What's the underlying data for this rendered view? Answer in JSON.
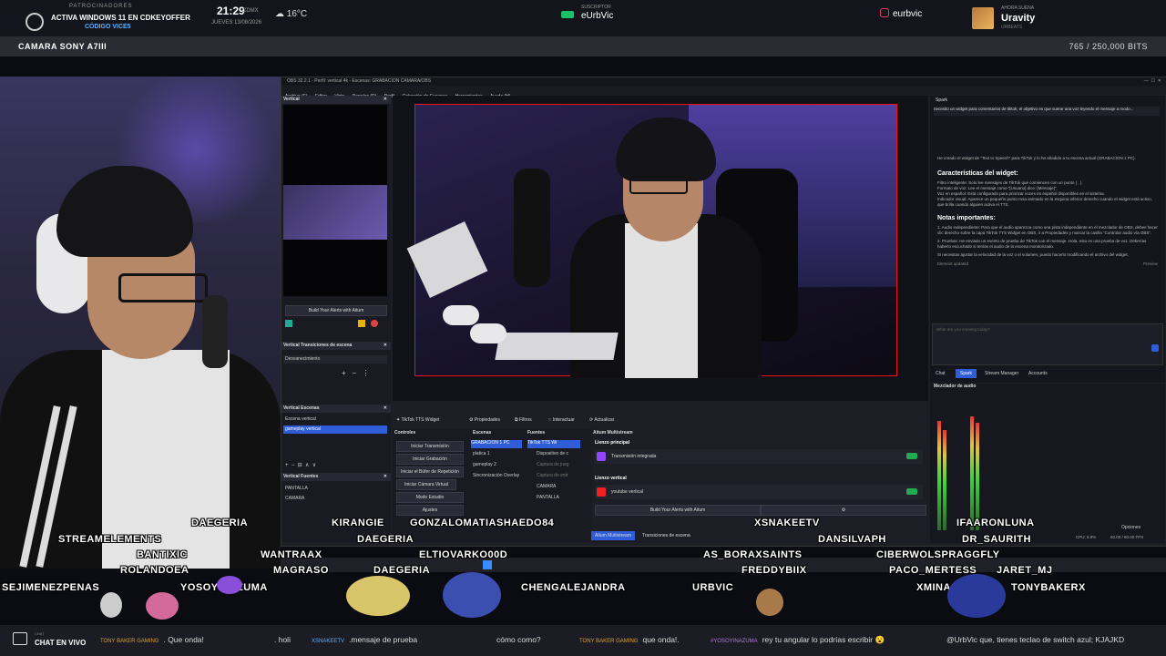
{
  "topbar": {
    "sponsor_label": "PATROCINADORES",
    "sponsor_line1": "ACTIVA WINDOWS 11 EN CDKEYOFFER",
    "sponsor_line2": "CÓDIGO VICE5",
    "time": "21:29",
    "tz": "CDMX",
    "date": "JUEVES 13/08/2026",
    "weather": "16°C",
    "sub_label": "SUSCRIPTOR",
    "sub_name": "eUrbVic",
    "instagram": "eurbvic",
    "follow_label": "AHORA SUENA",
    "follow_name": "Uravity",
    "follow_sub": "URBEATS"
  },
  "camstrip": {
    "title": "CAMARA SONY A7III",
    "bits": "765 / 250,000 BITS"
  },
  "obs": {
    "title": "OBS 32.2.1 - Perfil: vertical 4k - Escenas: GRABACION CAMARA/OBS",
    "menu": [
      "Archivo (F)",
      "Editar",
      "Vista",
      "Paneles (D)",
      "Perfil",
      "Colección de Escenas",
      "Herramientas",
      "Ayuda (H)"
    ],
    "left": {
      "vertical_label": "Vertical",
      "alerts_button": "Build Your Alerts with Aitum",
      "transitions_label": "Vertical Transiciones de escena",
      "transition_value": "Desvanecimiento",
      "scenes_label": "Vertical Escenas",
      "scenes": [
        "Escena vertical",
        "gameplay vertical"
      ],
      "sources_label": "Vertical Fuentes",
      "sources": [
        "PANTALLA",
        "CAMARA"
      ]
    },
    "toolbar": {
      "source": "TikTok TTS Widget",
      "props": "Propiedades",
      "filters": "Filtros",
      "interact": "Interactuar",
      "refresh": "Actualizar"
    },
    "controls": {
      "label": "Controles",
      "items": [
        "Iniciar Transmisión",
        "Iniciar Grabación",
        "Iniciar el Búfer de Repetición",
        "Iniciar Cámara Virtual",
        "Modo Estudio",
        "Ajustes"
      ]
    },
    "scenes": {
      "label": "Escenas",
      "items": [
        "GRABACION 1 PC",
        "platica 1",
        "gameplay 2",
        "Sincronización Overlay"
      ]
    },
    "sources": {
      "label": "Fuentes",
      "items": [
        "TikTok TTS Wi",
        "Dispositivo de c",
        "Captura de jueg",
        "Captura de entr",
        "CAMARA",
        "PANTALLA"
      ]
    },
    "multistream": {
      "label": "Aitum Multistream",
      "main": "Lienzo principal",
      "integrated": "Transmisión integrada",
      "vertical": "Lienzo vertical",
      "yt": "youtube vertical",
      "alerts": "Build Your Alerts with Aitum",
      "tabs": [
        "Aitum Multistream",
        "Transiciones de escena"
      ]
    },
    "spark": {
      "title": "Spark",
      "prompt": "necesito un widget para comentarios de tiktok, el objetivo es que suene una voz leyendo el mensaje a modo...",
      "para1": "He creado el widget de \"Text to Speech\" para TikTok y lo he añadido a tu escena actual (GRABACION 1 PC).",
      "h1": "Características del widget:",
      "bullets": [
        "Filtro inteligente: Solo lee mensajes de TikTok que comiencen con un punto ( . ).",
        "Formato de voz: Lee el mensaje como \"[Usuario] dice: [Mensaje]\".",
        "Voz en español: Está configurado para priorizar voces en español disponibles en el sistema.",
        "Indicador visual: Aparece un pequeño punto rosa animado en la esquina inferior derecho cuando el widget está activo, que brilla cuando alguien activa el TTS."
      ],
      "h2": "Notas importantes:",
      "notes": [
        "1. Audio independiente: Para que el audio aparezca como una pista independiente en el mezclador de OBS, debes hacer clic derecho sobre la capa TikTok TTS Widget en OBS, ir a Propiedades y marcar la casilla \"Controlar audio vía OBS\".",
        "2. Pruebas: He enviado un evento de prueba de TikTok con el mensaje .Hola, esto es una prueba de voz. Deberías haberlo escuchado si tenías el audio de la escena monitorizado."
      ],
      "para2": "Si necesitas ajustar la velocidad de la voz o el volumen, puedo hacerlo modificando el archivo del widget.",
      "element": "Element updated",
      "preview": "Preview",
      "input_placeholder": "What are you creating today?",
      "tabs": [
        "Chat",
        "Spark",
        "Stream Manager",
        "Accounts"
      ]
    },
    "mixer": {
      "label": "Mezclador de audio",
      "status": "CPU: 6.9%",
      "fps": "60.00 / 60.00 FPS",
      "options": "Opciones"
    }
  },
  "overlay_names": [
    "STREAMELEMENTS",
    "DAEGERIA",
    "KIRANGIE",
    "GONZALOMATIASHAEDO84",
    "XSNAKEETV",
    "IFAARONLUNA",
    "BANTIXIC",
    "WANTRAAX",
    "DAEGERIA",
    "DANSILVAPH",
    "DR_SAURITH",
    "ROLANDOEA",
    "MAGRASO",
    "ELTIOVARKO00D",
    "AS_BORAXSAINTS",
    "CIBERWOLSPRAGGFLY",
    "DAEGERIA",
    "FREDDYBIIX",
    "PACO_MERTESS",
    "JARET_MJ",
    "SEJIMENEZPENAS",
    "YOSOYINAZUMA",
    "CHENGALEJANDRA",
    "URBVIC",
    "XMINAGOD",
    "TONYBAKERX"
  ],
  "chat": {
    "label": "CHAT EN VIVO",
    "sub": "CHAT",
    "messages": [
      {
        "user": "TONY BAKER GAMING",
        "text": ". Que onda!"
      },
      {
        "user": "",
        "text": ". holi"
      },
      {
        "user": "XSNAKEETV",
        "text": ".mensaje de prueba"
      },
      {
        "user": "",
        "text": "cómo como?"
      },
      {
        "user": "TONY BAKER GAMING",
        "text": "que onda!."
      },
      {
        "user": "#YOSOYINAZUMA",
        "text": "rey tu angular lo podrías escribir 😮"
      },
      {
        "user": "",
        "text": "@UrbVic que, tienes teclao de switch azul; KJAJKD"
      }
    ]
  },
  "colors": {
    "accent": "#2f5dd8",
    "red_bounds": "#e11111",
    "sub_green": "#19c26b"
  }
}
